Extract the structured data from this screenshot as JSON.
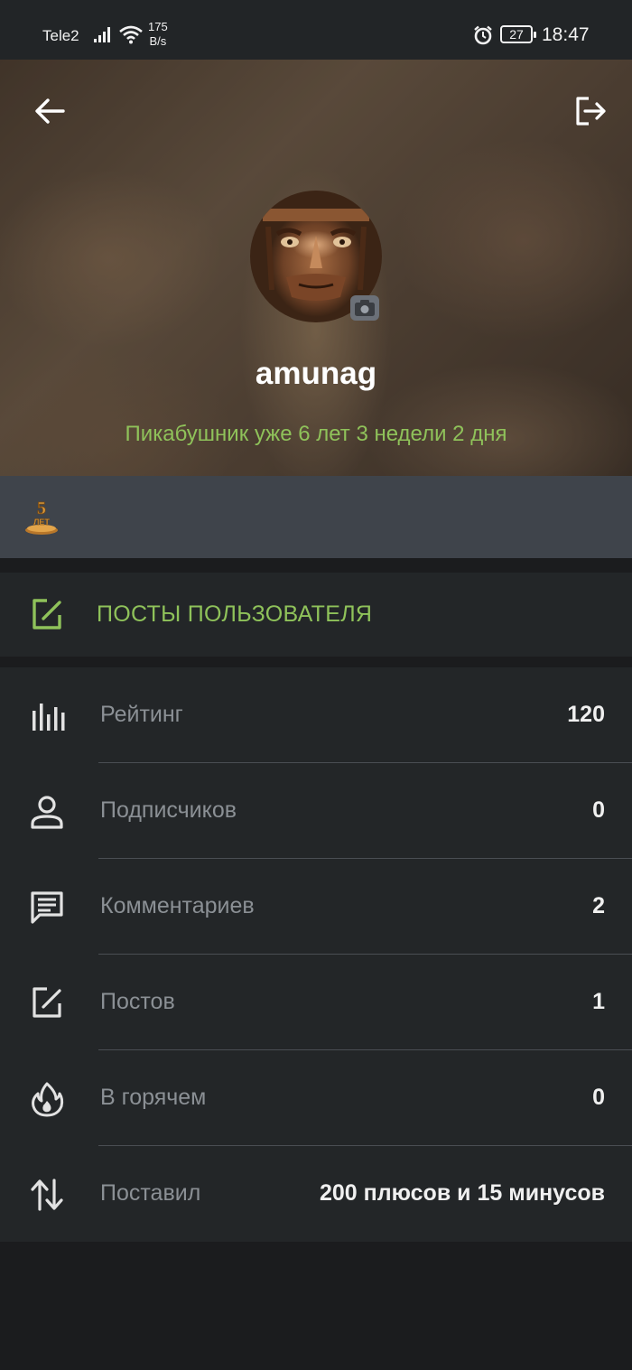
{
  "status_bar": {
    "carrier": "Tele2",
    "speed_value": "175",
    "speed_unit": "B/s",
    "battery": "27",
    "time": "18:47"
  },
  "profile": {
    "username": "amunag",
    "since": "Пикабушник уже 6 лет 3 недели 2 дня",
    "award_icon": "5-years-award-icon"
  },
  "posts_link": {
    "label": "ПОСТЫ ПОЛЬЗОВАТЕЛЯ"
  },
  "stats": [
    {
      "icon": "bar-chart-icon",
      "label": "Рейтинг",
      "value": "120"
    },
    {
      "icon": "person-icon",
      "label": "Подписчиков",
      "value": "0"
    },
    {
      "icon": "comment-icon",
      "label": "Комментариев",
      "value": "2"
    },
    {
      "icon": "edit-icon",
      "label": "Постов",
      "value": "1"
    },
    {
      "icon": "fire-icon",
      "label": "В горячем",
      "value": "0"
    },
    {
      "icon": "up-down-arrows-icon",
      "label": "Поставил",
      "value": "200 плюсов и 15 минусов"
    }
  ],
  "colors": {
    "accent_green": "#8fc25a",
    "panel": "#232628",
    "background": "#1b1c1e"
  }
}
